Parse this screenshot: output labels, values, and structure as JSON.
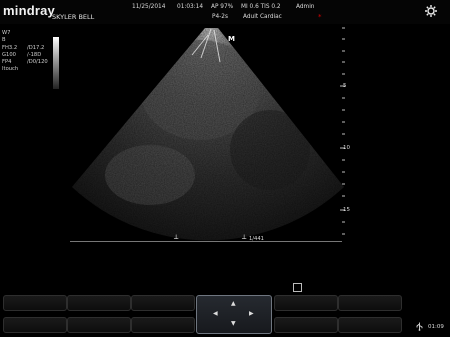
{
  "header": {
    "logo": "mindray",
    "patient_name": "SKYLER BELL",
    "date": "11/25/2014",
    "time": "01:03:14",
    "ap": "AP  97%",
    "mi_tis": "MI 0.6  TIS 0.2",
    "user": "Admin",
    "probe": "P4-2s",
    "exam": "Adult Cardiac",
    "rec_indicator": "*"
  },
  "params": [
    {
      "label": "W7",
      "value": ""
    },
    {
      "label": "B",
      "value": ""
    },
    {
      "label": "FH3.2",
      "value": "/D17.2"
    },
    {
      "label": "G100",
      "value": "/-18D"
    },
    {
      "label": "FP4",
      "value": "/D0/120"
    },
    {
      "label": "Itouch",
      "value": ""
    }
  ],
  "image": {
    "marker": "M",
    "depth_ticks": [
      "5",
      "10",
      "15"
    ],
    "frame_counter": "1/441"
  },
  "footer": {
    "clock": "01:09"
  },
  "icons": {
    "settings": "gear-icon",
    "usb": "usb-icon",
    "cine": "cine-review-icon"
  },
  "colors": {
    "header_bg": "#050505",
    "rec_dot": "#dd0000",
    "dpad_border": "#6f7680"
  }
}
